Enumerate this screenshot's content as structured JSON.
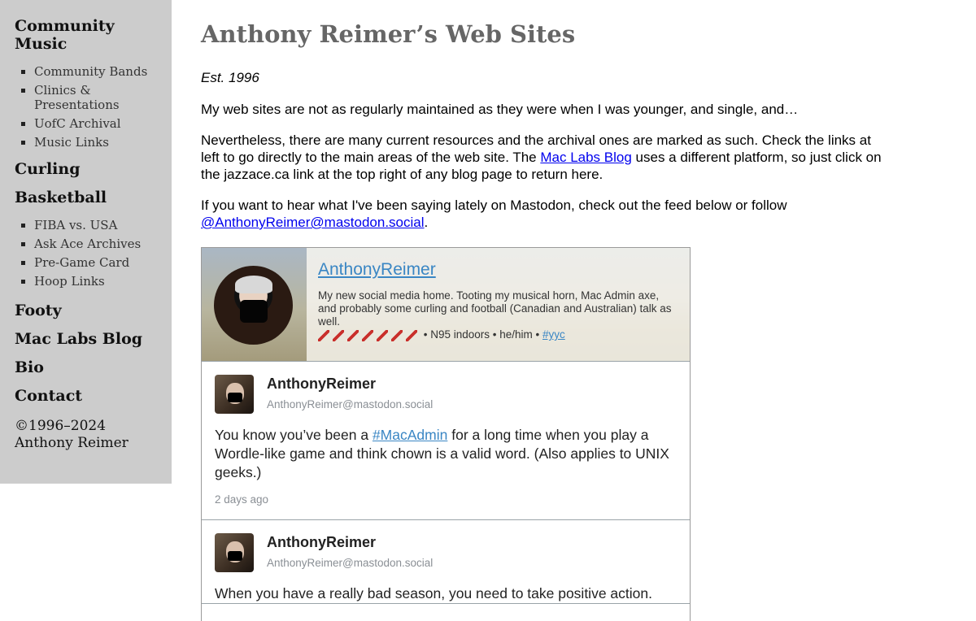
{
  "sidebar": {
    "community_music": "Community Music",
    "music_links": [
      "Community Bands",
      "Clinics & Presentations",
      "UofC Archival",
      "Music Links"
    ],
    "curling": "Curling",
    "basketball": "Basketball",
    "basketball_links": [
      "FIBA vs. USA",
      "Ask Ace Archives",
      "Pre-Game Card",
      "Hoop Links"
    ],
    "footy": "Footy",
    "mac_labs_blog": "Mac Labs Blog",
    "bio": "Bio",
    "contact": "Contact",
    "copyright": "©1996–2024 Anthony Reimer"
  },
  "main": {
    "title": "Anthony Reimer’s Web Sites",
    "est": "Est. 1996",
    "para1": "My web sites are not as regularly maintained as they were when I was younger, and single, and…",
    "para2_before": "Nevertheless, there are many current resources and the archival ones are marked as such. Check the links at left to go directly to the main areas of the web site. The ",
    "para2_link": "Mac Labs Blog",
    "para2_after": " uses a different platform, so just click on the jazzace.ca link at the top right of any blog page to return here.",
    "para3_before": "If you want to hear what I've been saying lately on Mastodon, check out the feed below or follow ",
    "para3_link": "@AnthonyReimer@mastodon.social",
    "para3_after": "."
  },
  "feed": {
    "profile_name": "AnthonyReimer",
    "profile_bio": "My new social media home. Tooting my musical horn, Mac Admin axe, and probably some curling and football (Canadian and Australian) talk as well.",
    "profile_meta": " • N95 indoors • he/him • ",
    "profile_tag": "#yyc",
    "syringe_count": 7,
    "posts": [
      {
        "author": "AnthonyReimer",
        "handle": "AnthonyReimer@mastodon.social",
        "text_before": "You know you’ve been a ",
        "tag": "#MacAdmin",
        "text_after": " for a long time when you play a Wordle-like game and think chown is a valid word. (Also applies to UNIX geeks.)",
        "time": "2 days ago"
      },
      {
        "author": "AnthonyReimer",
        "handle": "AnthonyReimer@mastodon.social",
        "text": "When you have a really bad season, you need to take positive action."
      }
    ]
  }
}
